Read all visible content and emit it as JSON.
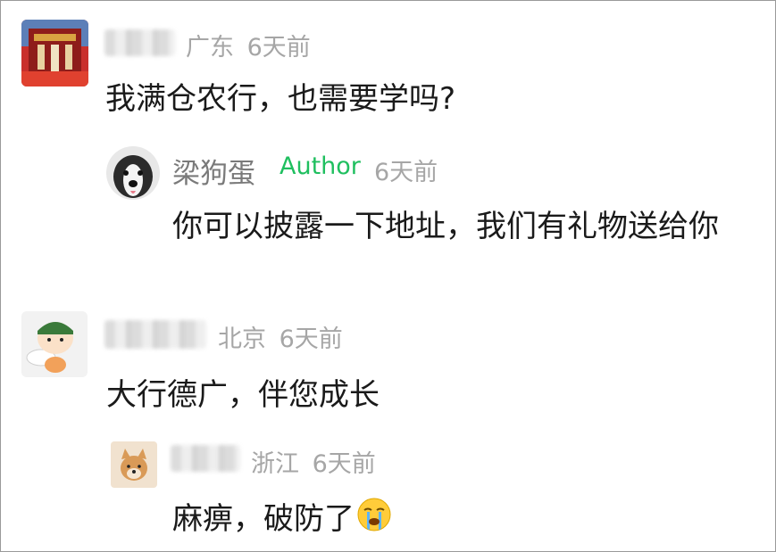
{
  "comments": [
    {
      "location": "广东",
      "time": "6天前",
      "text": "我满仓农行，也需要学吗?",
      "reply": {
        "name": "梁狗蛋",
        "badge": "Author",
        "time": "6天前",
        "text": "你可以披露一下地址，我们有礼物送给你"
      }
    },
    {
      "location": "北京",
      "time": "6天前",
      "text": "大行德广，伴您成长",
      "reply": {
        "location": "浙江",
        "time": "6天前",
        "text": "麻痹，破防了"
      }
    }
  ],
  "colors": {
    "author_badge": "#1fbf5f",
    "meta_text": "#a6a6a6",
    "name_text": "#7a7a7a",
    "body_text": "#1a1a1a"
  }
}
